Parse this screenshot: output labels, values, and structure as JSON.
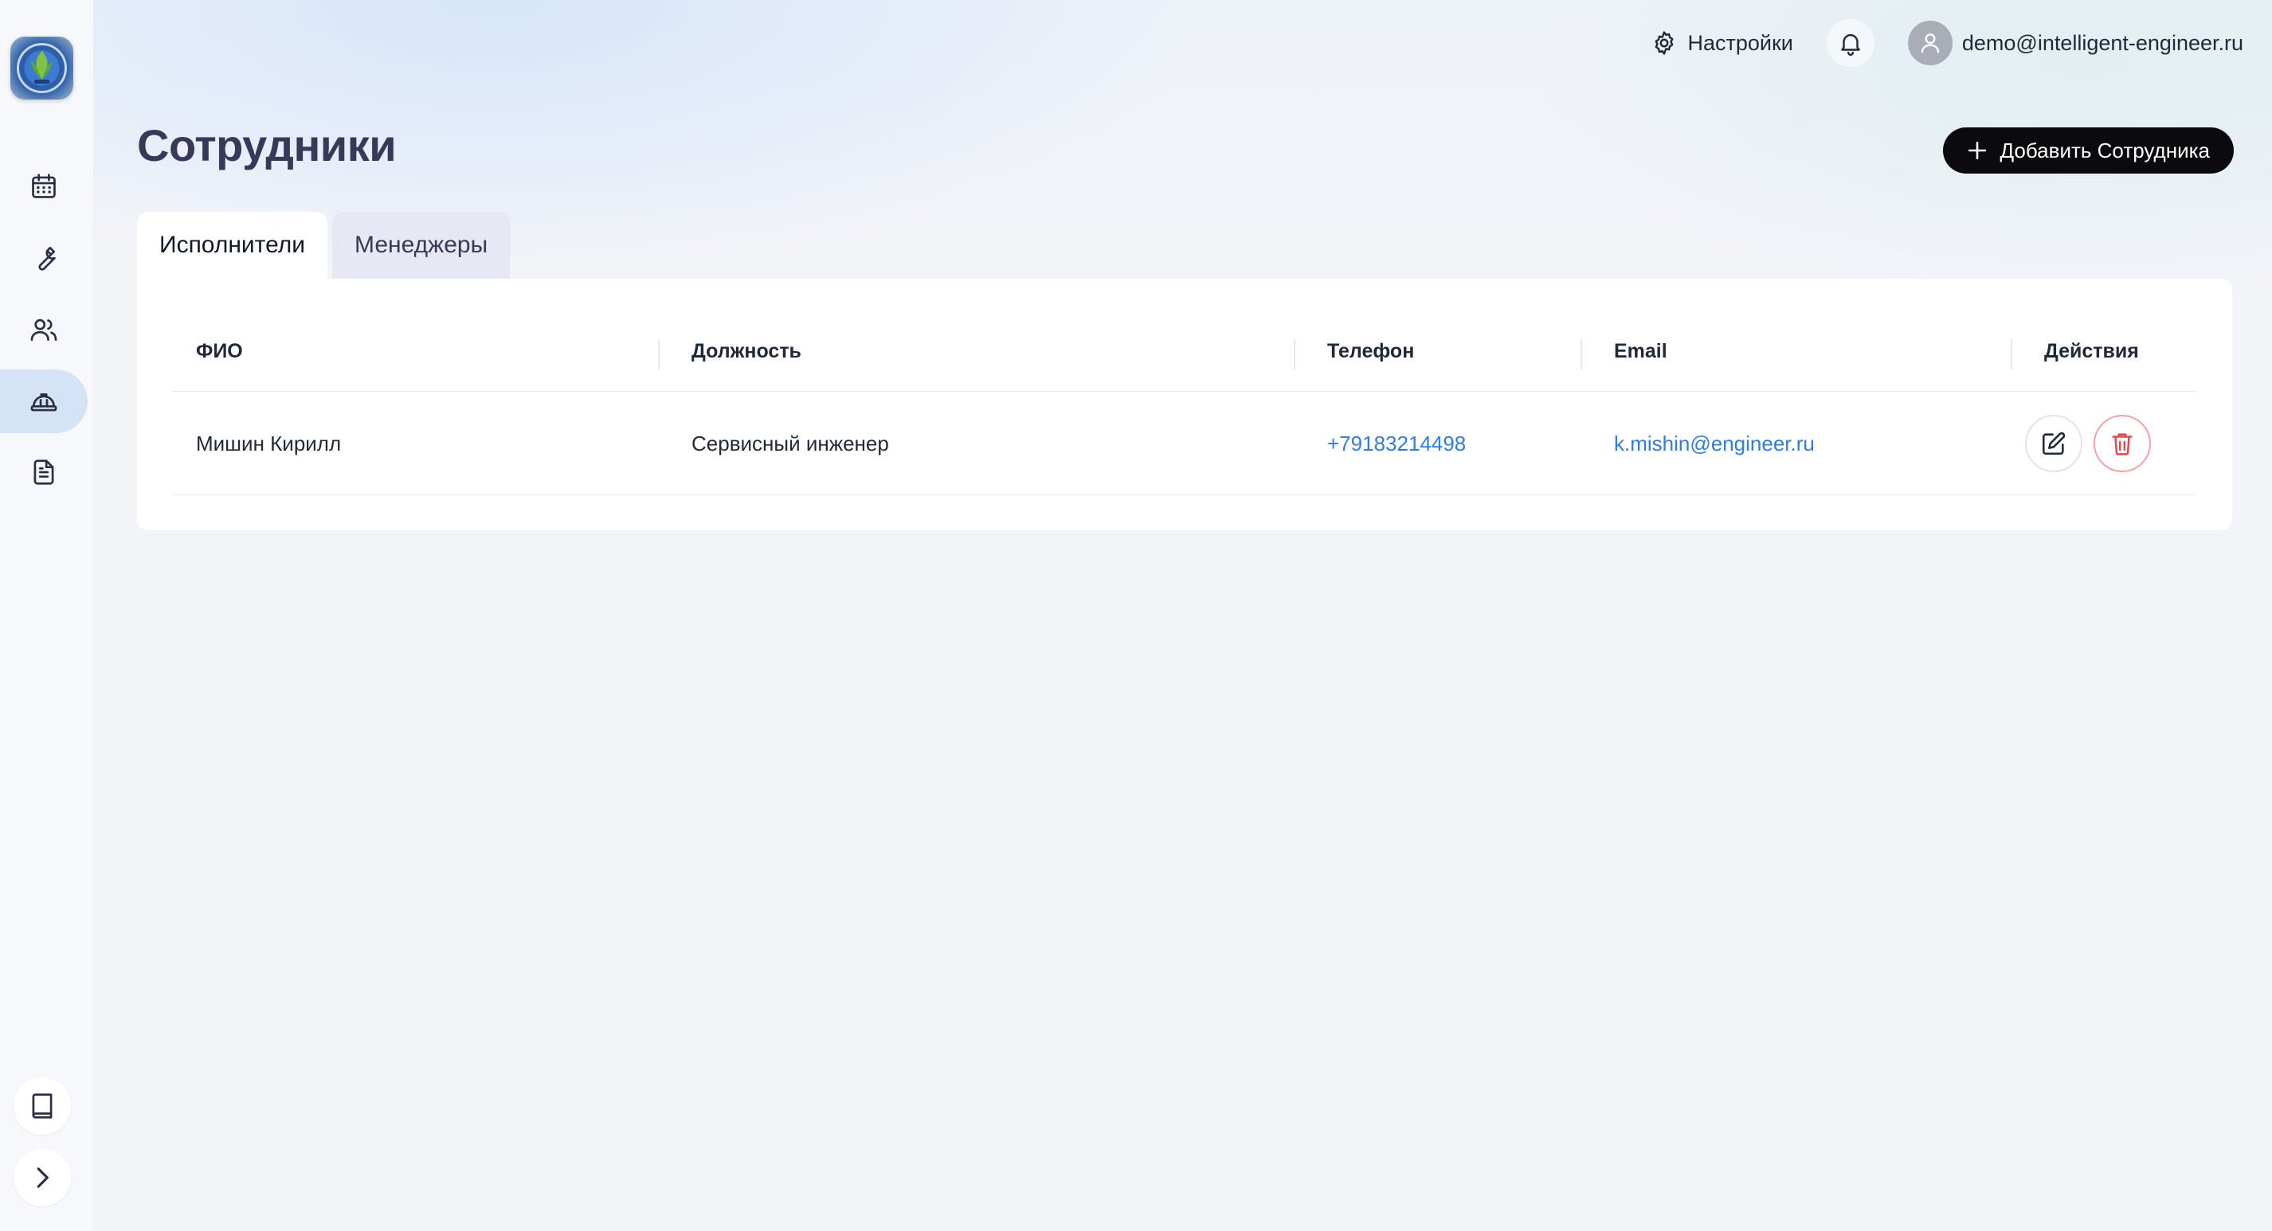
{
  "header": {
    "settings_label": "Настройки",
    "user_email": "demo@intelligent-engineer.ru"
  },
  "page": {
    "title": "Сотрудники",
    "add_button_label": "Добавить Сотрудника"
  },
  "tabs": [
    {
      "label": "Исполнители",
      "active": true
    },
    {
      "label": "Менеджеры",
      "active": false
    }
  ],
  "table": {
    "columns": [
      "ФИО",
      "Должность",
      "Телефон",
      "Email",
      "Действия"
    ],
    "rows": [
      {
        "name": "Мишин Кирилл",
        "position": "Сервисный инженер",
        "phone": "+79183214498",
        "email": "k.mishin@engineer.ru"
      }
    ]
  },
  "sidebar": {
    "items": [
      {
        "icon": "calendar-icon"
      },
      {
        "icon": "wrench-icon"
      },
      {
        "icon": "users-icon"
      },
      {
        "icon": "hard-hat-icon",
        "active": true
      },
      {
        "icon": "document-icon"
      }
    ],
    "bottom": [
      {
        "icon": "book-icon"
      },
      {
        "icon": "chevron-right-icon"
      }
    ]
  },
  "colors": {
    "accent_link": "#2f7de1",
    "primary_button": "#0b0b0f",
    "title": "#3a3858",
    "active_nav": "#d5e3f7",
    "danger": "#e5484d"
  }
}
